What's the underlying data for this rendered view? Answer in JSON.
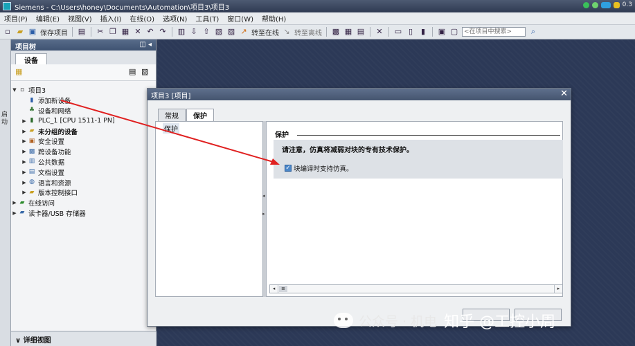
{
  "titlebar": {
    "app": "Siemens",
    "path": "Siemens  -  C:\\Users\\honey\\Documents\\Automation\\项目3\\项目3",
    "right_text": "0.3"
  },
  "menu": [
    "项目(P)",
    "编辑(E)",
    "视图(V)",
    "插入(I)",
    "在线(O)",
    "选项(N)",
    "工具(T)",
    "窗口(W)",
    "帮助(H)"
  ],
  "toolbar": {
    "save_project": "保存项目",
    "go_online": "转至在线",
    "go_offline": "转至离线",
    "search_placeholder": "<在项目中搜索>"
  },
  "side_strip": {
    "label": "启动"
  },
  "project_tree": {
    "header": "项目树",
    "tab": "设备",
    "items": [
      {
        "label": "项目3",
        "level": 0,
        "expanded": true,
        "icon": "project-icon"
      },
      {
        "label": "添加新设备",
        "level": 1,
        "icon": "add-device-icon"
      },
      {
        "label": "设备和网络",
        "level": 1,
        "icon": "network-icon"
      },
      {
        "label": "PLC_1 [CPU 1511-1 PN]",
        "level": 1,
        "icon": "plc-icon"
      },
      {
        "label": "未分组的设备",
        "level": 1,
        "icon": "folder-icon",
        "bold": true
      },
      {
        "label": "安全设置",
        "level": 1,
        "icon": "security-icon"
      },
      {
        "label": "跨设备功能",
        "level": 1,
        "icon": "cross-device-icon"
      },
      {
        "label": "公共数据",
        "level": 1,
        "icon": "common-data-icon"
      },
      {
        "label": "文档设置",
        "level": 1,
        "icon": "document-icon"
      },
      {
        "label": "语言和资源",
        "level": 1,
        "icon": "language-icon"
      },
      {
        "label": "版本控制接口",
        "level": 1,
        "icon": "version-control-icon"
      },
      {
        "label": "在线访问",
        "level": 0,
        "icon": "online-access-icon"
      },
      {
        "label": "读卡器/USB 存储器",
        "level": 0,
        "icon": "card-reader-icon"
      }
    ],
    "details_view": "详细视图"
  },
  "dialog": {
    "title": "项目3 [项目]",
    "tabs": [
      {
        "label": "常规",
        "active": false
      },
      {
        "label": "保护",
        "active": true
      }
    ],
    "nav_items": [
      "保护"
    ],
    "section_title": "保护",
    "info_text": "请注意，仿真将减弱对块的专有技术保护。",
    "checkbox_label": "块编译时支持仿真。",
    "checkbox_checked": true
  },
  "watermark": {
    "text_a": "公众号 · 机电",
    "text_b": "知乎 @工控小周"
  },
  "colors": {
    "annotation_arrow": "#e02020",
    "titlebar": "#3c4862",
    "workspace": "#2c3957"
  }
}
